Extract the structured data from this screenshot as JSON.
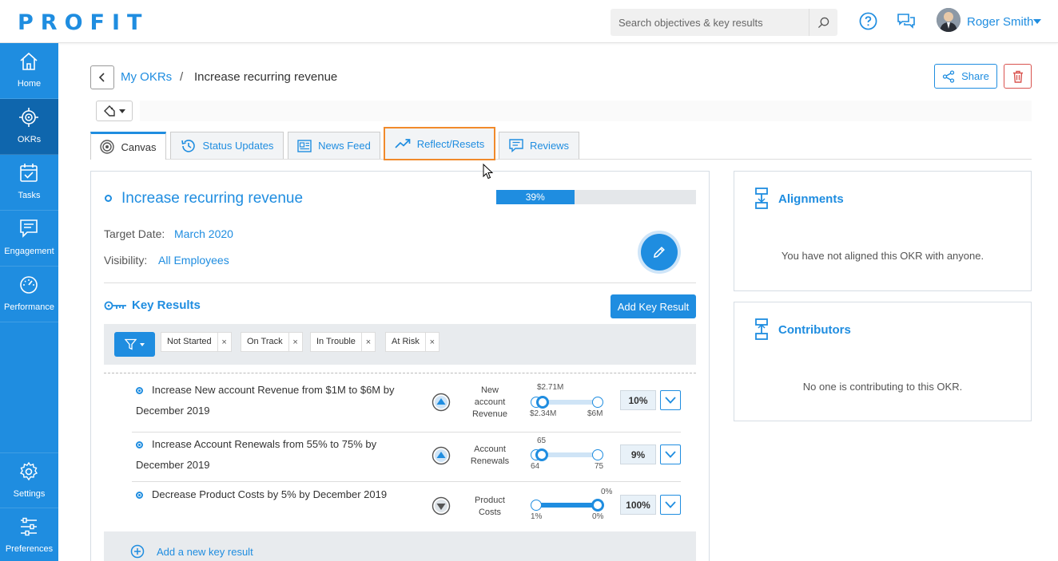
{
  "app": {
    "logo": "PROFIT"
  },
  "header": {
    "search_placeholder": "Search objectives & key results",
    "user_name": "Roger Smith"
  },
  "sidebar": {
    "items": [
      {
        "label": "Home",
        "icon": "home-icon"
      },
      {
        "label": "OKRs",
        "icon": "target-icon",
        "active": true
      },
      {
        "label": "Tasks",
        "icon": "calendar-check-icon"
      },
      {
        "label": "Engagement",
        "icon": "chat-icon"
      },
      {
        "label": "Performance",
        "icon": "gauge-icon"
      },
      {
        "label": "Settings",
        "icon": "gear-icon"
      },
      {
        "label": "Preferences",
        "icon": "sliders-icon"
      }
    ]
  },
  "breadcrumb": {
    "parent": "My OKRs",
    "separator": "/",
    "current": "Increase recurring revenue"
  },
  "actions": {
    "share_label": "Share"
  },
  "tabs": [
    {
      "label": "Canvas",
      "icon": "target-icon",
      "active": true
    },
    {
      "label": "Status Updates",
      "icon": "history-icon"
    },
    {
      "label": "News Feed",
      "icon": "newspaper-icon"
    },
    {
      "label": "Reflect/Resets",
      "icon": "trend-up-icon",
      "highlighted": true
    },
    {
      "label": "Reviews",
      "icon": "comment-icon"
    }
  ],
  "okr": {
    "title": "Increase recurring revenue",
    "progress_label": "39%",
    "progress_value": 0.39,
    "target_date_label": "Target Date:",
    "target_date": "March 2020",
    "visibility_label": "Visibility:",
    "visibility": "All Employees"
  },
  "key_results": {
    "title": "Key Results",
    "add_button": "Add Key Result",
    "filters": [
      "Not Started",
      "On Track",
      "In Trouble",
      "At Risk"
    ],
    "filter_remove": "×",
    "items": [
      {
        "text": "Increase New account Revenue from $1M to $6M by December 2019",
        "direction": "up",
        "metric": "New account Revenue",
        "current": "$2.71M",
        "start": "$2.34M",
        "target": "$6M",
        "percent": "10%"
      },
      {
        "text": "Increase Account Renewals from 55% to 75% by December 2019",
        "direction": "up",
        "metric": "Account Renewals",
        "current": "65",
        "start": "64",
        "target": "75",
        "percent": "9%"
      },
      {
        "text": "Decrease Product Costs by 5% by December 2019",
        "direction": "down",
        "metric": "Product Costs",
        "current": "0%",
        "start": "1%",
        "target": "0%",
        "percent": "100%"
      }
    ],
    "add_link": "Add a new key result"
  },
  "alignments": {
    "title": "Alignments",
    "message": "You have not aligned this OKR with anyone."
  },
  "contributors": {
    "title": "Contributors",
    "message": "No one is contributing to this OKR."
  },
  "colors": {
    "accent": "#1f8de0",
    "sidebar_active": "#0f66ad",
    "highlight": "#f18a2b",
    "danger": "#d9534f"
  }
}
